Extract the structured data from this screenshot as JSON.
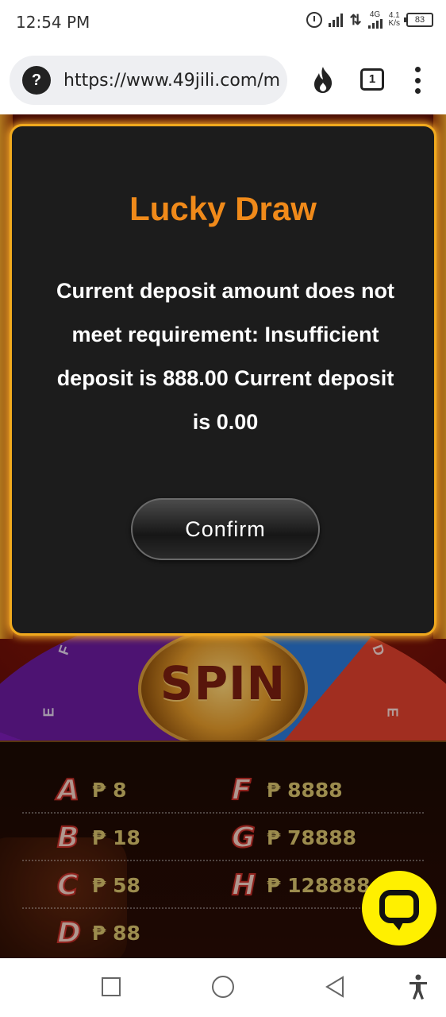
{
  "status_bar": {
    "time": "12:54 PM",
    "network_type": "4G",
    "speed": "4.1\nK/s",
    "battery": "83"
  },
  "browser": {
    "url": "https://www.49jili.com/m",
    "site_info_icon": "?",
    "tab_count": "1",
    "icons": [
      "site-info-icon",
      "flame-icon",
      "tabs-icon",
      "menu-icon"
    ]
  },
  "game": {
    "spin_label": "SPIN",
    "wheel_letters": [
      "F",
      "D",
      "E",
      "E"
    ],
    "prizes": [
      {
        "letter": "A",
        "value": "₱ 8"
      },
      {
        "letter": "F",
        "value": "₱ 8888"
      },
      {
        "letter": "B",
        "value": "₱ 18"
      },
      {
        "letter": "G",
        "value": "₱ 78888"
      },
      {
        "letter": "C",
        "value": "₱ 58"
      },
      {
        "letter": "H",
        "value": "₱ 128888"
      },
      {
        "letter": "D",
        "value": "₱ 88"
      }
    ]
  },
  "modal": {
    "title": "Lucky Draw",
    "message": "Current deposit amount does not meet requirement: Insufficient deposit is 888.00 Current deposit is 0.00",
    "confirm_label": "Confirm"
  },
  "colors": {
    "title_orange": "#f08a1a",
    "modal_border": "#f0a91e",
    "chat_yellow": "#fff000"
  },
  "nav": {
    "icons": [
      "recents-icon",
      "home-icon",
      "back-icon",
      "accessibility-icon"
    ]
  }
}
